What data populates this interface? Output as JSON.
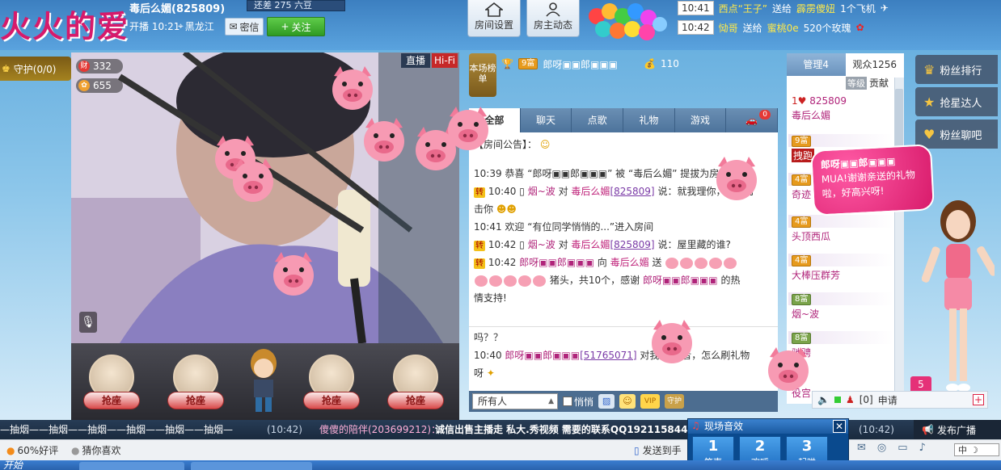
{
  "header": {
    "room_title": "火火的爱",
    "host_label": "毒后么媚(825809)",
    "gift_counter": "还差 275 六豆",
    "live_time": "开播 10:21",
    "location": "黑龙江",
    "message_label": "密信",
    "follow_label": "关注",
    "room_settings_label": "房间设置",
    "host_dynamic_label": "房主动态"
  },
  "gift_ticker": [
    {
      "time": "10:41",
      "user": "西点“王子”",
      "action": "送给",
      "target": "霹雳傻妞",
      "gift": "1个飞机"
    },
    {
      "time": "10:42",
      "user": "恸哥",
      "action": "送给",
      "target": "蜜桃0e",
      "gift": "520个玫瑰"
    }
  ],
  "guard": {
    "label": "守护(0/0)"
  },
  "video": {
    "live_badge": "直播",
    "hifi_badge": "Hi-Fi",
    "wealth_value": "332",
    "charm_value": "655",
    "wealth_icon": "财"
  },
  "seats": [
    {
      "label": "抢座"
    },
    {
      "label": "抢座"
    },
    {
      "label": "抢座"
    },
    {
      "label": "抢座"
    }
  ],
  "anchor_rank": {
    "label": "本场榜单"
  },
  "top_fan": {
    "level": "9富",
    "name": "郎呀▣▣郎▣▣▣",
    "amount": "110"
  },
  "chat_tabs": [
    {
      "label": "全部",
      "active": true
    },
    {
      "label": "聊天",
      "active": false
    },
    {
      "label": "点歌",
      "active": false
    },
    {
      "label": "礼物",
      "active": false
    },
    {
      "label": "游戏",
      "active": false
    },
    {
      "label": "",
      "active": false,
      "badge": "0"
    }
  ],
  "chat_messages": {
    "announcement": "【房间公告】：",
    "line1_time": "10:39",
    "line1_text": "恭喜 “郎呀▣▣郎▣▣▣” 被 “毒后么媚” 提拔为房间管",
    "line2_time": "10:40",
    "line2_user": "烟~波",
    "line2_mid": "对",
    "line2_host": "毒后么媚",
    "line2_id": "[825809]",
    "line2_text": "说：就我理你，我过打",
    "line2_tail": "击你",
    "line3_time": "10:41",
    "line3_text": "欢迎 “有位同学悄悄的...”进入房间",
    "line4_time": "10:42",
    "line4_user": "烟~波",
    "line4_mid": "对",
    "line4_host": "毒后么媚",
    "line4_id": "[825809]",
    "line4_text": "说：屋里藏的谁?",
    "line5_time": "10:42",
    "line5_user": "郎呀▣▣郎▣▣▣",
    "line5_mid": "向",
    "line5_host": "毒后么媚",
    "line5_action": "送",
    "line6_text": "猪头，共10个，感谢",
    "line6_user": "郎呀▣▣郎▣▣▣",
    "line6_tail": "的热",
    "line7_text": "情支持!",
    "lower_line1": "吗？？",
    "lower_line2_time": "10:40",
    "lower_line2_user": "郎呀▣▣郎▣▣▣",
    "lower_line2_id": "[51765071]",
    "lower_line2_text": "对我说：",
    "lower_line2_tail": "者，怎么刷礼物",
    "lower_line3": "呀"
  },
  "chat_input": {
    "recipient": "所有人",
    "private_label": "悄悄",
    "vip_label": "VIP",
    "guard_label": "守护"
  },
  "viewer_panel": {
    "tab_admin": "管理4",
    "tab_audience": "观众1256",
    "level_label": "等级",
    "contribution_label": "贡献",
    "host_id": "825809",
    "viewers": [
      {
        "level": "",
        "name": "毒后么媚"
      },
      {
        "level": "9富",
        "name": "拽跑"
      },
      {
        "level": "4富",
        "name": "奇迹"
      },
      {
        "level": "4富",
        "name": "头顶西瓜"
      },
      {
        "level": "4富",
        "name": "大棒压群芳"
      },
      {
        "level": "8富",
        "name": "烟~波"
      },
      {
        "level": "8富",
        "name": "驰骋"
      },
      {
        "level": "",
        "name": "役宫"
      }
    ]
  },
  "side_buttons": [
    {
      "label": "粉丝排行",
      "icon": "crown-icon"
    },
    {
      "label": "抢星达人",
      "icon": "star-icon"
    },
    {
      "label": "粉丝聊吧",
      "icon": "heart-icon"
    }
  ],
  "speech_bubble": {
    "name": "郎呀▣▣郎▣▣▣",
    "text": "MUA!谢谢亲送的礼物啦，好高兴呀!"
  },
  "apply_bar": {
    "count_badge": "5",
    "mic_count": "[0]",
    "apply_label": "申请"
  },
  "broadcast": {
    "drift_text": "—抽烟——抽烟——抽烟——抽烟——抽烟——抽烟—",
    "time": "(10:42)",
    "user": "傻傻的陪伴(203699212)：",
    "text": "诚信出售主播走 私大.秀视频 需要的联系QQ192115844",
    "time2": "(10:42)",
    "button_label": "发布广播"
  },
  "effects_panel": {
    "title": "现场音效",
    "close_label": "✕",
    "buttons": [
      {
        "num": "1",
        "label": "笑声"
      },
      {
        "num": "2",
        "label": "欢呼"
      },
      {
        "num": "3",
        "label": "起哄"
      }
    ]
  },
  "status_bar": {
    "rating": "60%好评",
    "guess_label": "猜你喜欢",
    "send_to_label": "发送到手",
    "ime_label": "中"
  },
  "taskbar": {
    "start_label": "开始"
  }
}
